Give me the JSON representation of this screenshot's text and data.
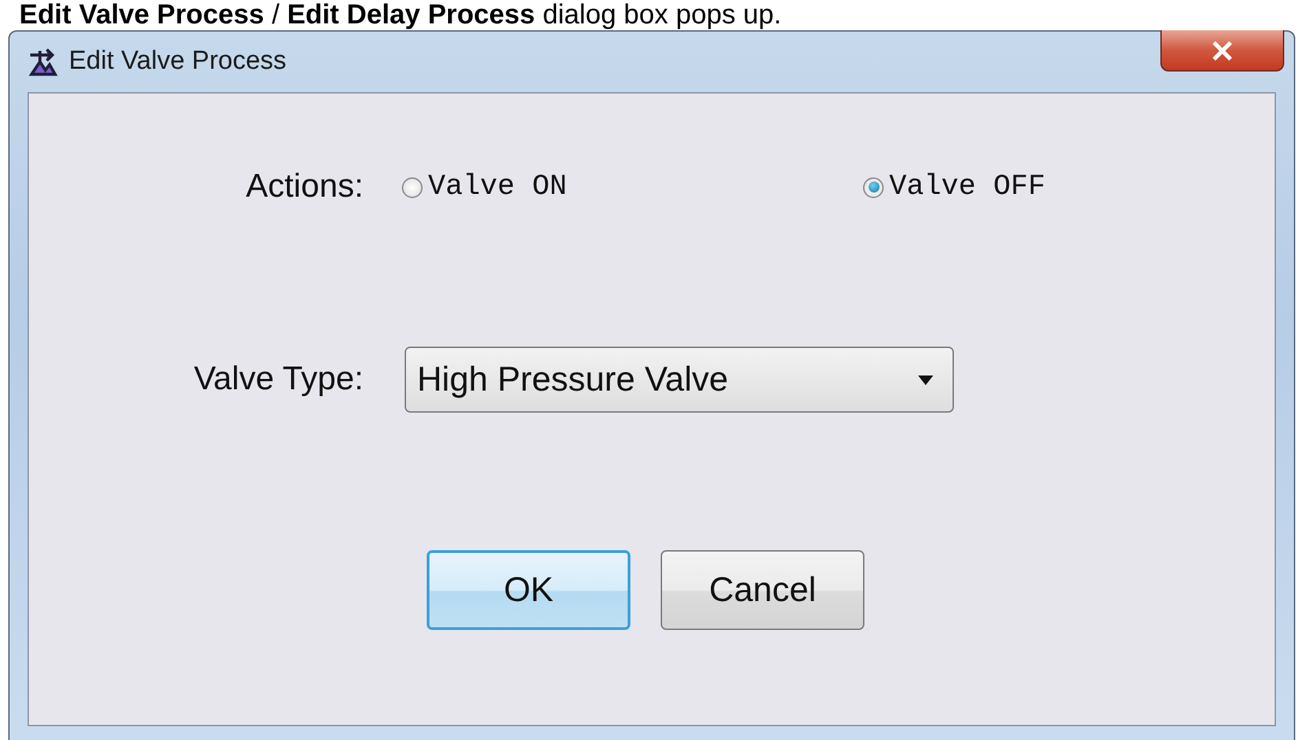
{
  "caption": "**Edit Valve Process** / **Edit Delay Process** dialog box pops up.",
  "window": {
    "title": "Edit Valve Process"
  },
  "actions": {
    "label": "Actions:",
    "options": [
      {
        "label": "Valve ON",
        "selected": false
      },
      {
        "label": "Valve OFF",
        "selected": true
      }
    ]
  },
  "valve_type": {
    "label": "Valve Type:",
    "value": "High Pressure Valve"
  },
  "buttons": [
    {
      "label": "OK",
      "kind": "default"
    },
    {
      "label": "Cancel",
      "kind": "normal"
    }
  ]
}
